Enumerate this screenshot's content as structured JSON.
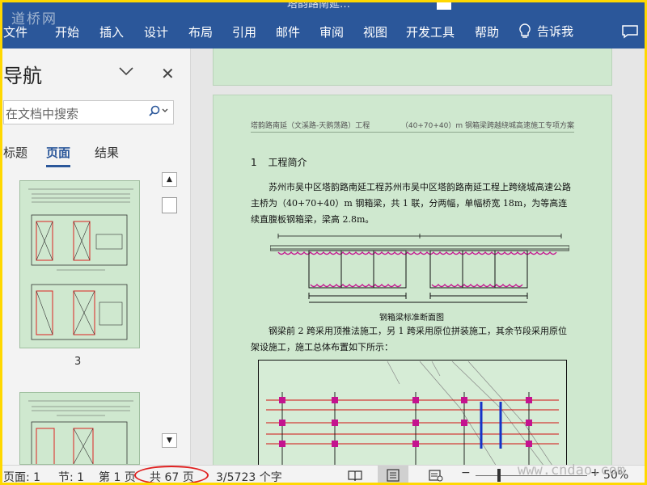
{
  "window": {
    "title_fragment": "塔韵路南延…",
    "watermark_top": "道桥网",
    "watermark_bottom": "www.cndao.com"
  },
  "ribbon": {
    "menu": [
      "文件",
      "开始",
      "插入",
      "设计",
      "布局",
      "引用",
      "邮件",
      "审阅",
      "视图",
      "开发工具",
      "帮助"
    ],
    "tell_me": "告诉我"
  },
  "nav": {
    "title": "导航",
    "search_placeholder": "在文档中搜索",
    "tabs": [
      "标题",
      "页面",
      "结果"
    ],
    "active_tab": "页面",
    "thumb_page_label": "3"
  },
  "document": {
    "header_left": "塔韵路南延（文溪路-天鹅荡路）工程",
    "header_right": "（40+70+40）m 钢箱梁跨越绕城高速施工专项方案",
    "section_number": "1",
    "section_title": "工程简介",
    "para1": "苏州市吴中区塔韵路南延工程苏州市吴中区塔韵路南延工程上跨绕城高速公路主桥为（40+70+40）m 钢箱梁，共 1 联，分两幅，单幅桥宽 18m，为等高连续直腹板钢箱梁，梁高 2.8m。",
    "figure_caption": "钢箱梁标准断面图",
    "para2": "钢梁前 2 跨采用顶推法施工，另 1 跨采用原位拼装施工，其余节段采用原位架设施工，施工总体布置如下所示："
  },
  "status": {
    "page": "页面: 1",
    "section": "节: 1",
    "page_of": "第 1 页",
    "total_pages": "共 67 页",
    "word_count": "3/5723 个字",
    "zoom": "50%"
  },
  "colors": {
    "ribbon": "#2b579a",
    "page_bg": "#cfe8cf",
    "highlight": "#e02020",
    "frame": "#ffd800"
  }
}
